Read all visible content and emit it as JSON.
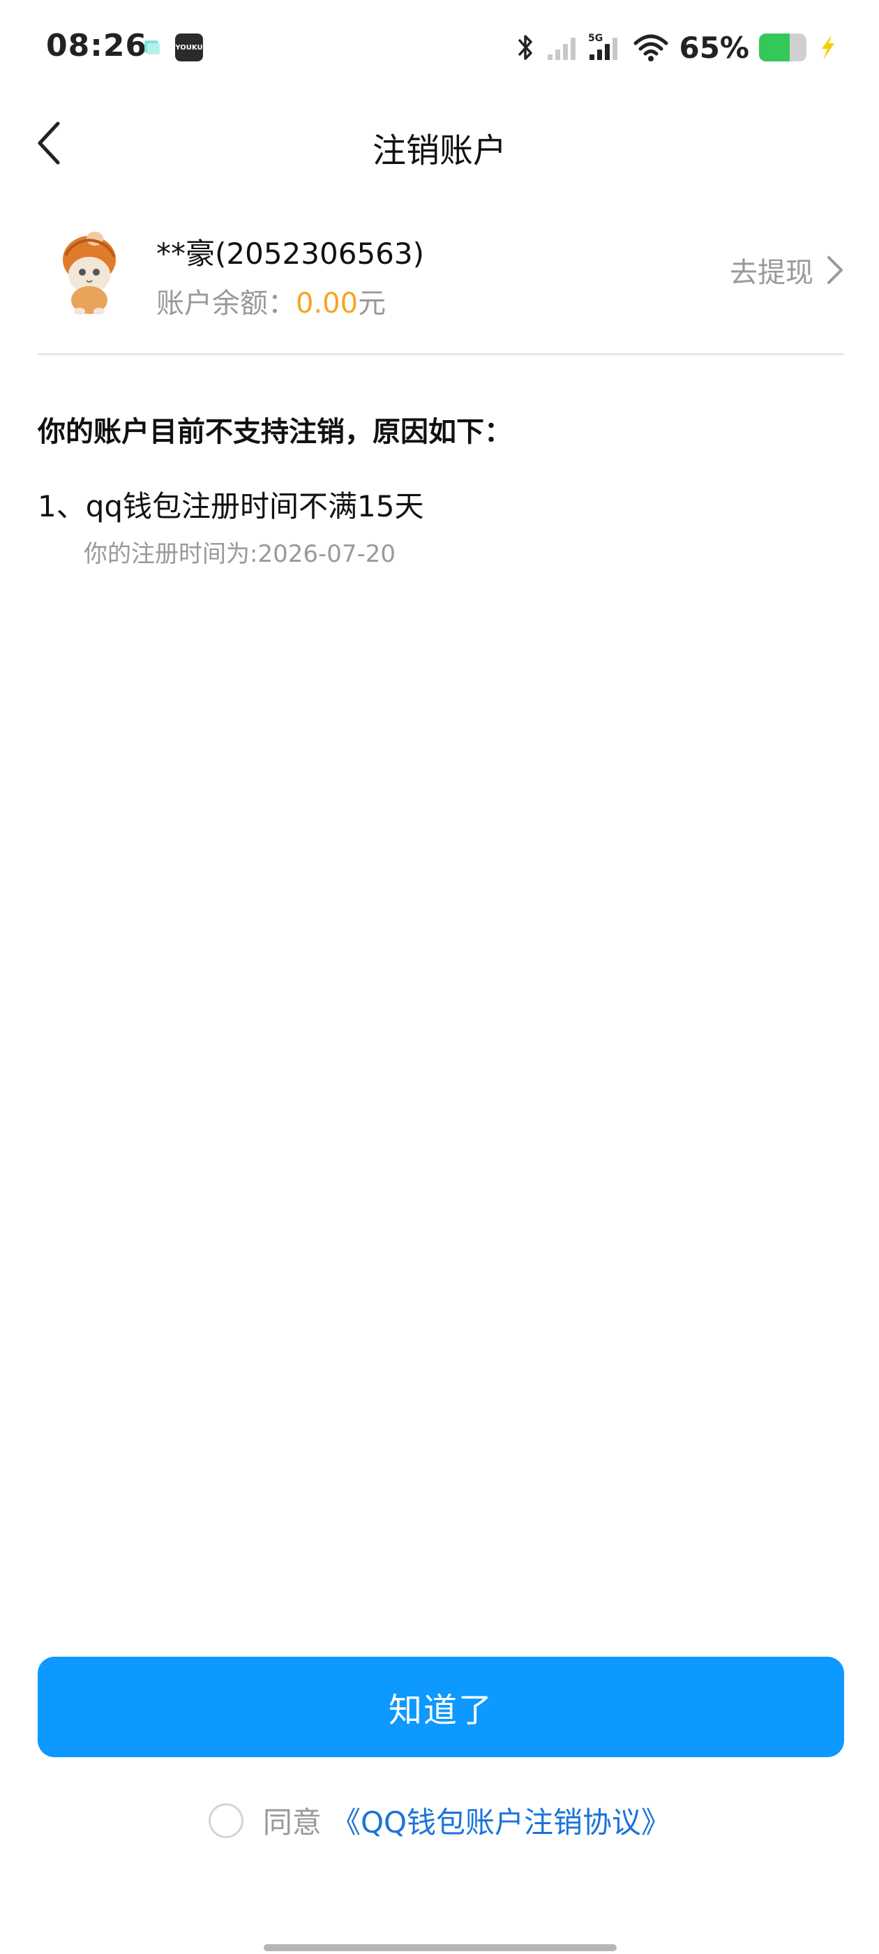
{
  "status_bar": {
    "time": "08:26",
    "notification_icons": [
      "chat-app-icon",
      "youku-app-icon"
    ],
    "notif_b_label": "YOUKU",
    "network_label": "5G",
    "battery_text": "65%",
    "battery_level": 0.65,
    "battery_color": "#34c759",
    "charging_color": "#f5d000",
    "icons": [
      "bluetooth-icon",
      "signal-icon",
      "signal-5g-icon",
      "wifi-icon",
      "battery-icon",
      "charging-icon"
    ]
  },
  "nav": {
    "back_icon": "chevron-left-icon",
    "title": "注销账户"
  },
  "account": {
    "avatar_icon": "cat-avatar-icon",
    "name": "**豪(2052306563)",
    "balance_label": "账户余额：",
    "balance_amount": "0.00",
    "balance_unit": "元",
    "withdraw_label": "去提现",
    "withdraw_icon": "chevron-right-icon"
  },
  "reasons": {
    "heading": "你的账户目前不支持注销，原因如下：",
    "items": [
      {
        "title": "1、qq钱包注册时间不满15天",
        "detail": "你的注册时间为:2026-07-20"
      }
    ]
  },
  "actions": {
    "confirm_label": "知道了",
    "agree_text": "同意",
    "agreement_link": "《QQ钱包账户注销协议》"
  },
  "colors": {
    "primary": "#0d99ff",
    "amount": "#f5a623",
    "link": "#1a73d9",
    "secondary_text": "#999999"
  }
}
